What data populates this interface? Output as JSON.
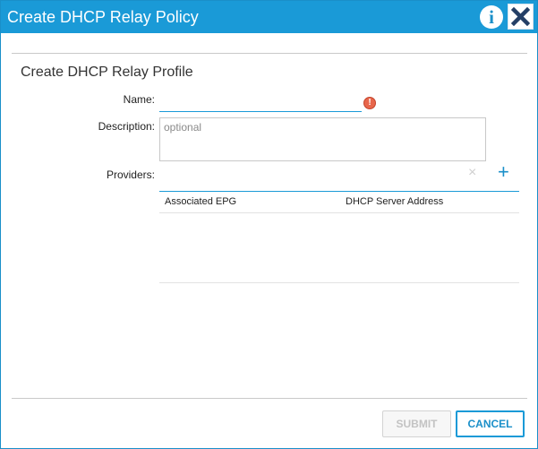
{
  "dialog": {
    "title": "Create DHCP Relay Policy",
    "info_icon": "i",
    "close_icon": "close-x"
  },
  "form": {
    "section_title": "Create DHCP Relay Profile",
    "name_label": "Name:",
    "name_value": "",
    "name_error_icon": "!",
    "description_label": "Description:",
    "description_placeholder": "optional",
    "providers_label": "Providers:",
    "providers_clear_icon": "×",
    "providers_add_icon": "+",
    "providers_columns": [
      "Associated EPG",
      "DHCP Server Address"
    ]
  },
  "footer": {
    "submit_label": "SUBMIT",
    "cancel_label": "CANCEL"
  },
  "colors": {
    "accent": "#1a9ad7",
    "error": "#e8664b"
  }
}
